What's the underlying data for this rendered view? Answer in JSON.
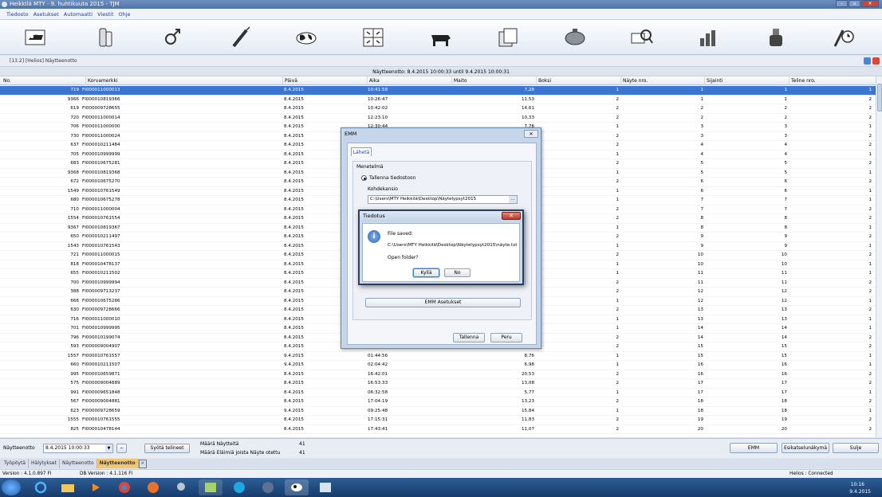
{
  "window": {
    "title": "Heikkilä MTY - 9. huhtikuuta 2015 - TJM",
    "btn_min": "–",
    "btn_max": "▫",
    "btn_close": "✕"
  },
  "menu": [
    "Tiedosto",
    "Asetukset",
    "Automaatti",
    "Viestit",
    "Ohje"
  ],
  "subheader": {
    "title": "[13.2] [Helios] Näytteenotto"
  },
  "band": {
    "text": "Näytteenotto: 8.4.2015 10:00:33 until 9.4.2015 10:00:31"
  },
  "columns": [
    "No.",
    "Korvamerkki",
    "Päivä",
    "Aika",
    "Maito",
    "Boksi",
    "Näyte nro.",
    "Sijainti",
    "Teline nro."
  ],
  "rows": [
    [
      "719",
      "FI000011000013",
      "8.4.2015",
      "10:41:58",
      "7,28",
      "",
      "1",
      "1",
      "1",
      "1"
    ],
    [
      "9366",
      "FI000010819366",
      "8.4.2015",
      "10:26:47",
      "11,53",
      "",
      "2",
      "1",
      "1",
      "2"
    ],
    [
      "619",
      "FI000009728655",
      "8.4.2015",
      "10:42:02",
      "14,61",
      "",
      "2",
      "2",
      "2",
      "2"
    ],
    [
      "720",
      "FI000011000014",
      "8.4.2015",
      "12:23:10",
      "10,33",
      "",
      "2",
      "2",
      "2",
      "2"
    ],
    [
      "706",
      "FI000011000000",
      "8.4.2015",
      "12:30:44",
      "7,78",
      "",
      "1",
      "3",
      "3",
      "1"
    ],
    [
      "730",
      "FI000011000024",
      "8.4.2015",
      "",
      "",
      "",
      "2",
      "3",
      "3",
      "2"
    ],
    [
      "637",
      "FI000010211484",
      "8.4.2015",
      "",
      "",
      "",
      "2",
      "4",
      "4",
      "2"
    ],
    [
      "705",
      "FI000010999999",
      "8.4.2015",
      "",
      "",
      "",
      "1",
      "4",
      "4",
      "1"
    ],
    [
      "683",
      "FI000010675281",
      "8.4.2015",
      "",
      "",
      "",
      "2",
      "5",
      "5",
      "2"
    ],
    [
      "9368",
      "FI000010819368",
      "8.4.2015",
      "",
      "",
      "",
      "1",
      "5",
      "5",
      "1"
    ],
    [
      "672",
      "FI000010675270",
      "8.4.2015",
      "",
      "",
      "",
      "2",
      "6",
      "6",
      "2"
    ],
    [
      "1549",
      "FI000010761549",
      "8.4.2015",
      "",
      "",
      "",
      "1",
      "6",
      "6",
      "1"
    ],
    [
      "680",
      "FI000010675278",
      "8.4.2015",
      "",
      "",
      "",
      "1",
      "7",
      "7",
      "1"
    ],
    [
      "710",
      "FI000011000004",
      "8.4.2015",
      "",
      "",
      "",
      "2",
      "7",
      "7",
      "2"
    ],
    [
      "1554",
      "FI000010761554",
      "8.4.2015",
      "",
      "",
      "",
      "2",
      "8",
      "8",
      "2"
    ],
    [
      "9367",
      "FI000010819367",
      "8.4.2015",
      "",
      "",
      "",
      "1",
      "8",
      "8",
      "1"
    ],
    [
      "650",
      "FI000010211497",
      "8.4.2015",
      "",
      "",
      "",
      "2",
      "9",
      "9",
      "2"
    ],
    [
      "1543",
      "FI000010761543",
      "8.4.2015",
      "",
      "",
      "",
      "1",
      "9",
      "9",
      "1"
    ],
    [
      "721",
      "FI000011000015",
      "8.4.2015",
      "",
      "",
      "",
      "2",
      "10",
      "10",
      "2"
    ],
    [
      "818",
      "FI000010478137",
      "8.4.2015",
      "",
      "",
      "",
      "1",
      "10",
      "10",
      "1"
    ],
    [
      "655",
      "FI000010211502",
      "8.4.2015",
      "",
      "",
      "",
      "1",
      "11",
      "11",
      "1"
    ],
    [
      "700",
      "FI000010999994",
      "8.4.2015",
      "",
      "",
      "",
      "2",
      "11",
      "11",
      "2"
    ],
    [
      "388",
      "FI000009713237",
      "8.4.2015",
      "",
      "",
      "",
      "2",
      "12",
      "12",
      "2"
    ],
    [
      "668",
      "FI000010675266",
      "8.4.2015",
      "",
      "",
      "",
      "1",
      "12",
      "12",
      "1"
    ],
    [
      "630",
      "FI000009728666",
      "8.4.2015",
      "",
      "",
      "",
      "2",
      "13",
      "13",
      "2"
    ],
    [
      "716",
      "FI000011000010",
      "8.4.2015",
      "",
      "",
      "",
      "1",
      "13",
      "13",
      "1"
    ],
    [
      "701",
      "FI000010999995",
      "8.4.2015",
      "",
      "",
      "",
      "1",
      "14",
      "14",
      "1"
    ],
    [
      "796",
      "FI000010199074",
      "8.4.2015",
      "",
      "",
      "",
      "2",
      "14",
      "14",
      "2"
    ],
    [
      "593",
      "FI000009004907",
      "8.4.2015",
      "",
      "",
      "",
      "2",
      "15",
      "15",
      "2"
    ],
    [
      "1557",
      "FI000010761557",
      "9.4.2015",
      "01:44:56",
      "8,76",
      "",
      "1",
      "15",
      "15",
      "1"
    ],
    [
      "660",
      "FI000010211507",
      "9.4.2015",
      "02:04:42",
      "6,98",
      "",
      "1",
      "16",
      "16",
      "1"
    ],
    [
      "995",
      "FI000010659871",
      "8.4.2015",
      "16:42:01",
      "20,53",
      "",
      "2",
      "16",
      "16",
      "2"
    ],
    [
      "575",
      "FI000009004889",
      "8.4.2015",
      "16:53:33",
      "13,08",
      "",
      "2",
      "17",
      "17",
      "2"
    ],
    [
      "991",
      "FI000009651848",
      "8.4.2015",
      "06:32:58",
      "5,77",
      "",
      "1",
      "17",
      "17",
      "1"
    ],
    [
      "567",
      "FI000009004881",
      "8.4.2015",
      "17:04:19",
      "13,23",
      "",
      "2",
      "18",
      "18",
      "2"
    ],
    [
      "623",
      "FI000009728659",
      "9.4.2015",
      "09:25:48",
      "15,84",
      "",
      "1",
      "18",
      "18",
      "1"
    ],
    [
      "1555",
      "FI000010761555",
      "8.4.2015",
      "17:15:31",
      "11,83",
      "",
      "2",
      "19",
      "19",
      "2"
    ],
    [
      "825",
      "FI000010478144",
      "8.4.2015",
      "17:43:41",
      "11,07",
      "",
      "2",
      "20",
      "20",
      "2"
    ]
  ],
  "bottom": {
    "label": "Näytteenotto",
    "combo_value": "8.4.2015 10:00:33",
    "minus": "−",
    "dropdown": "▼",
    "sync_button": "Syötä telineet",
    "count_label_1": "Määrä Näytteitä",
    "count_value_1": "41",
    "count_label_2": "Määrä Eläimiä joista Näyte otettu",
    "count_value_2": "41",
    "emm_button": "EMM",
    "preview_button": "Esikatselunäkymä",
    "close_button": "Sulje"
  },
  "tabs": [
    "Työpöytä",
    "Hälytykset",
    "Näytteenotto",
    "Näytteenotto"
  ],
  "tab_close": "✕",
  "status": {
    "version": "Version : 4.1.0.897 FI",
    "db_version": "DB Version : 4.1.116 FI",
    "connection": "Helios : Connected"
  },
  "tray": {
    "time": "10:16",
    "date": "9.4.2015"
  },
  "emm_dialog": {
    "title": "EMM",
    "close": "✕",
    "tab": "Lähetä",
    "group_label": "Menetelmä",
    "radio_label": "Tallenna tiedostoon",
    "folder_label": "Kohdekansio",
    "folder_value": "C:\\Users\\MTY Heikkilä\\Desktop\\Näytelypsyt2015",
    "browse": "...",
    "settings_button": "EMM Asetukset",
    "save_button": "Tallenna",
    "cancel_button": "Peru"
  },
  "message": {
    "title": "Tiedotus",
    "close": "✕",
    "line1": "File saved:",
    "line2": "C:\\Users\\MTY Heikkilä\\Desktop\\Näytelypsyt2015\\näyte.txt",
    "line3": "Open folder?",
    "yes": "Kyllä",
    "no": "No",
    "icon_glyph": "i"
  },
  "colors": {
    "selection": "#3c76d2",
    "title": "#4f74a9",
    "active_tab": "#f5c56a"
  }
}
